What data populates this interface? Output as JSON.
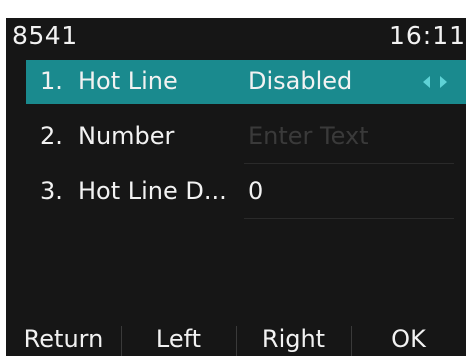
{
  "status": {
    "account": "8541",
    "time": "16:11"
  },
  "menu": {
    "items": [
      {
        "index": "1.",
        "label": "Hot Line",
        "value": "Disabled",
        "selected": true,
        "arrows_icon": "left-right-arrows-icon"
      },
      {
        "index": "2.",
        "label": "Number",
        "placeholder": "Enter Text",
        "value": ""
      },
      {
        "index": "3.",
        "label": "Hot Line D...",
        "value": "0"
      }
    ]
  },
  "softkeys": [
    {
      "label": "Return"
    },
    {
      "label": "Left"
    },
    {
      "label": "Right"
    },
    {
      "label": "OK"
    }
  ],
  "colors": {
    "screen_bg": "#161616",
    "highlight": "#1a8a8e",
    "arrow": "#5fd3d6",
    "text": "#f2f2f2"
  }
}
